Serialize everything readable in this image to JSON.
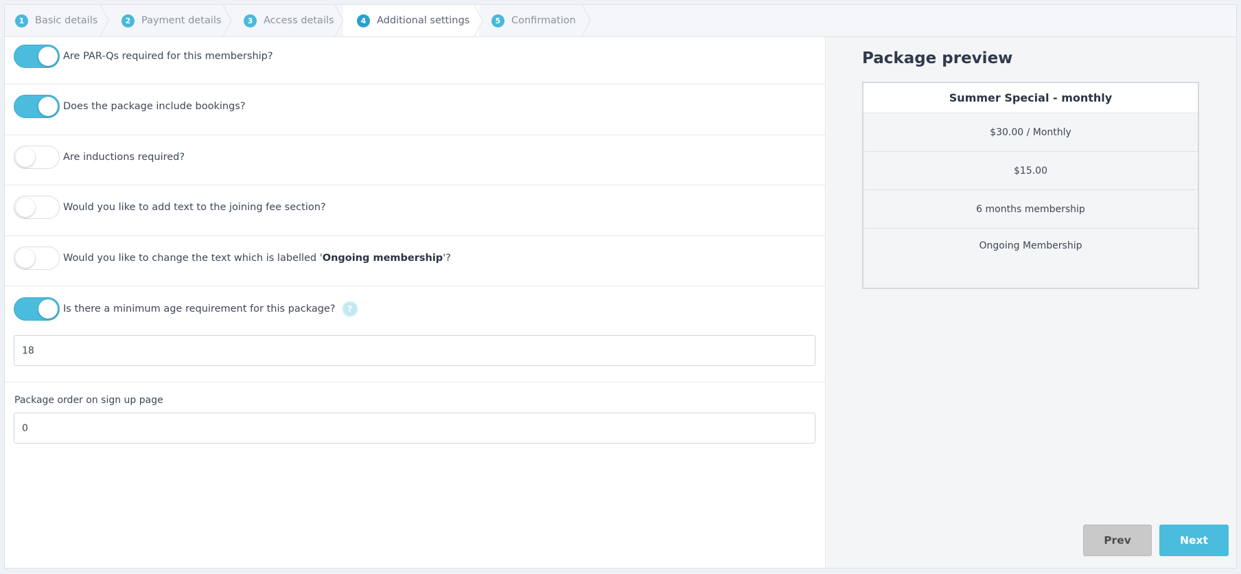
{
  "steps": [
    {
      "num": "1",
      "label": "Basic details"
    },
    {
      "num": "2",
      "label": "Payment details"
    },
    {
      "num": "3",
      "label": "Access details"
    },
    {
      "num": "4",
      "label": "Additional settings"
    },
    {
      "num": "5",
      "label": "Confirmation"
    }
  ],
  "active_step": 4,
  "form": {
    "toggles": [
      {
        "question": "Are PAR-Qs required for this membership?",
        "on": true
      },
      {
        "question": "Does the package include bookings?",
        "on": true
      },
      {
        "question": "Are inductions required?",
        "on": false
      },
      {
        "question": "Would you like to add text to the joining fee section?",
        "on": false
      },
      {
        "question_prefix": "Would you like to change the text which is labelled '",
        "question_bold": "Ongoing membership",
        "question_suffix": "'?",
        "on": false
      },
      {
        "question": "Is there a minimum age requirement for this package?",
        "on": true
      }
    ],
    "help_icon_glyph": "?",
    "min_age_value": "18",
    "package_order_label": "Package order on sign up page",
    "package_order_value": "0"
  },
  "preview": {
    "title": "Package preview",
    "package_name": "Summer Special - monthly",
    "price": "$30.00 / Monthly",
    "joining_fee": "$15.00",
    "duration": "6 months membership",
    "membership_type": "Ongoing Membership"
  },
  "buttons": {
    "prev": "Prev",
    "next": "Next"
  },
  "colors": {
    "accent": "#4bbcdd",
    "step_active": "#2a9fcf",
    "toggle_off_border": "#d9dde3",
    "prev_button": "#c9c9c9"
  },
  "icons": {
    "help": "help-circle-icon"
  }
}
